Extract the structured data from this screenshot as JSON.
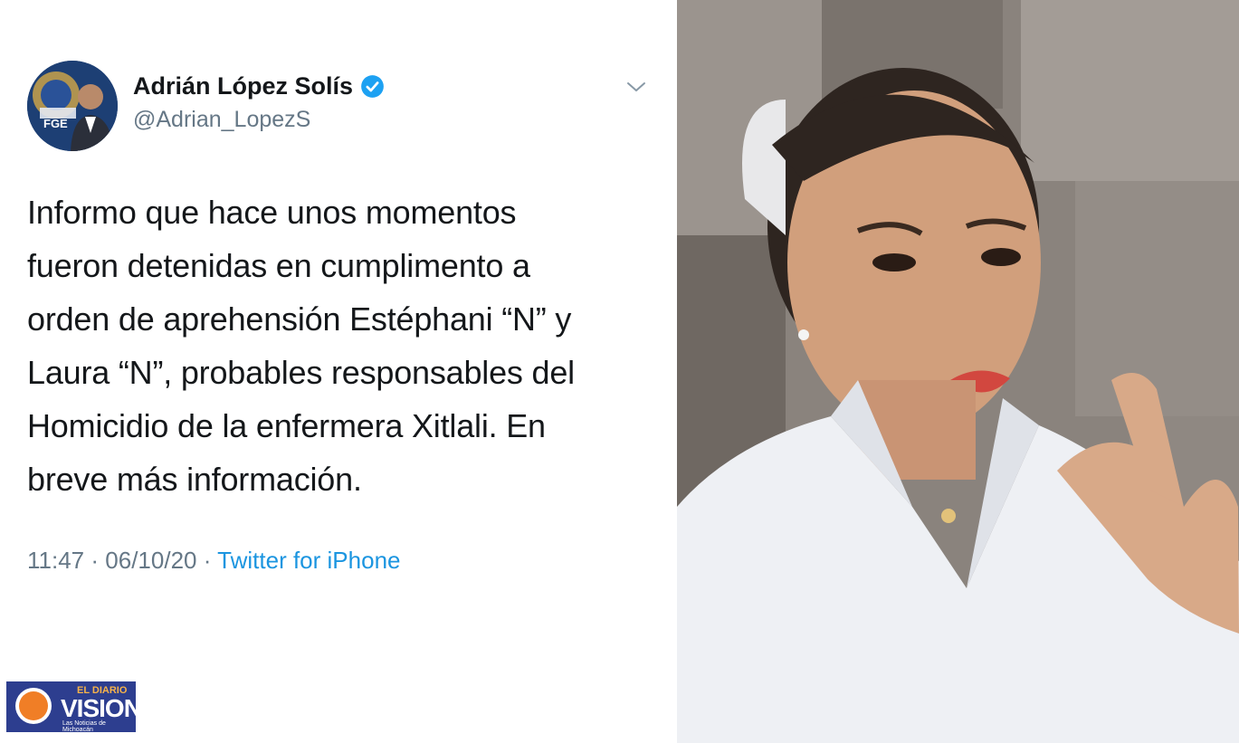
{
  "tweet": {
    "display_name": "Adrián López Solís",
    "handle": "@Adrian_LopezS",
    "avatar_badge_text": "FGE",
    "text_lines": [
      "Informo que hace unos momentos",
      "fueron detenidas en cumplimento a",
      "orden de aprehensión  Estéphani “N” y",
      "Laura “N”, probables responsables del",
      "Homicidio de la enfermera Xitlali. En",
      "breve más información."
    ],
    "time": "11:47",
    "date": "06/10/20",
    "separator": "·",
    "source": "Twitter for iPhone"
  },
  "watermark": {
    "small_text": "EL DIARIO",
    "big_text": "VISION",
    "tagline": "Las Noticias de Michoacán"
  },
  "colors": {
    "text": "#14171a",
    "secondary": "#657786",
    "link": "#1b95e0",
    "verified": "#1da1f2",
    "logo_bg": "#2d3e8f",
    "logo_accent": "#f07e26"
  }
}
